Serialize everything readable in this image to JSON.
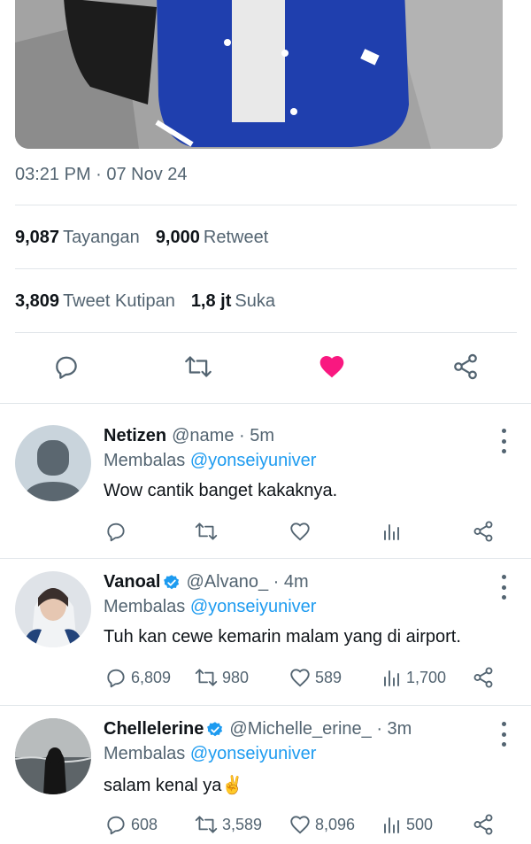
{
  "tweet": {
    "timestamp": "03:21 PM · 07 Nov 24",
    "stats_row1": [
      {
        "value": "9,087",
        "label": "Tayangan"
      },
      {
        "value": "9,000",
        "label": "Retweet"
      }
    ],
    "stats_row2": [
      {
        "value": "3,809",
        "label": "Tweet Kutipan"
      },
      {
        "value": "1,8 jt",
        "label": "Suka"
      }
    ],
    "actions": [
      "reply-icon",
      "retweet-icon",
      "heart-filled-icon",
      "share-icon"
    ],
    "liked": true
  },
  "colors": {
    "accent": "#1d9bf0",
    "like": "#f91880",
    "muted": "#536471",
    "text": "#0f1419"
  },
  "replies": [
    {
      "name": "Netizen",
      "verified": false,
      "handle": "@name · 5m",
      "replying_prefix": "Membalas",
      "replying_to": "@yonseiyuniver",
      "text": "Wow cantik banget kakaknya.",
      "counts": {
        "reply": "",
        "retweet": "",
        "like": "",
        "views": ""
      }
    },
    {
      "name": "Vanoal",
      "verified": true,
      "handle": "@Alvano_ · 4m",
      "replying_prefix": "Membalas",
      "replying_to": "@yonseiyuniver",
      "text": "Tuh kan cewe kemarin malam yang di airport.",
      "counts": {
        "reply": "6,809",
        "retweet": "980",
        "like": "589",
        "views": "1,700"
      }
    },
    {
      "name": "Chellelerine",
      "verified": true,
      "handle": "@Michelle_erine_ · 3m",
      "replying_prefix": "Membalas",
      "replying_to": "@yonseiyuniver",
      "text": "salam kenal ya✌️",
      "counts": {
        "reply": "608",
        "retweet": "3,589",
        "like": "8,096",
        "views": "500"
      }
    }
  ]
}
